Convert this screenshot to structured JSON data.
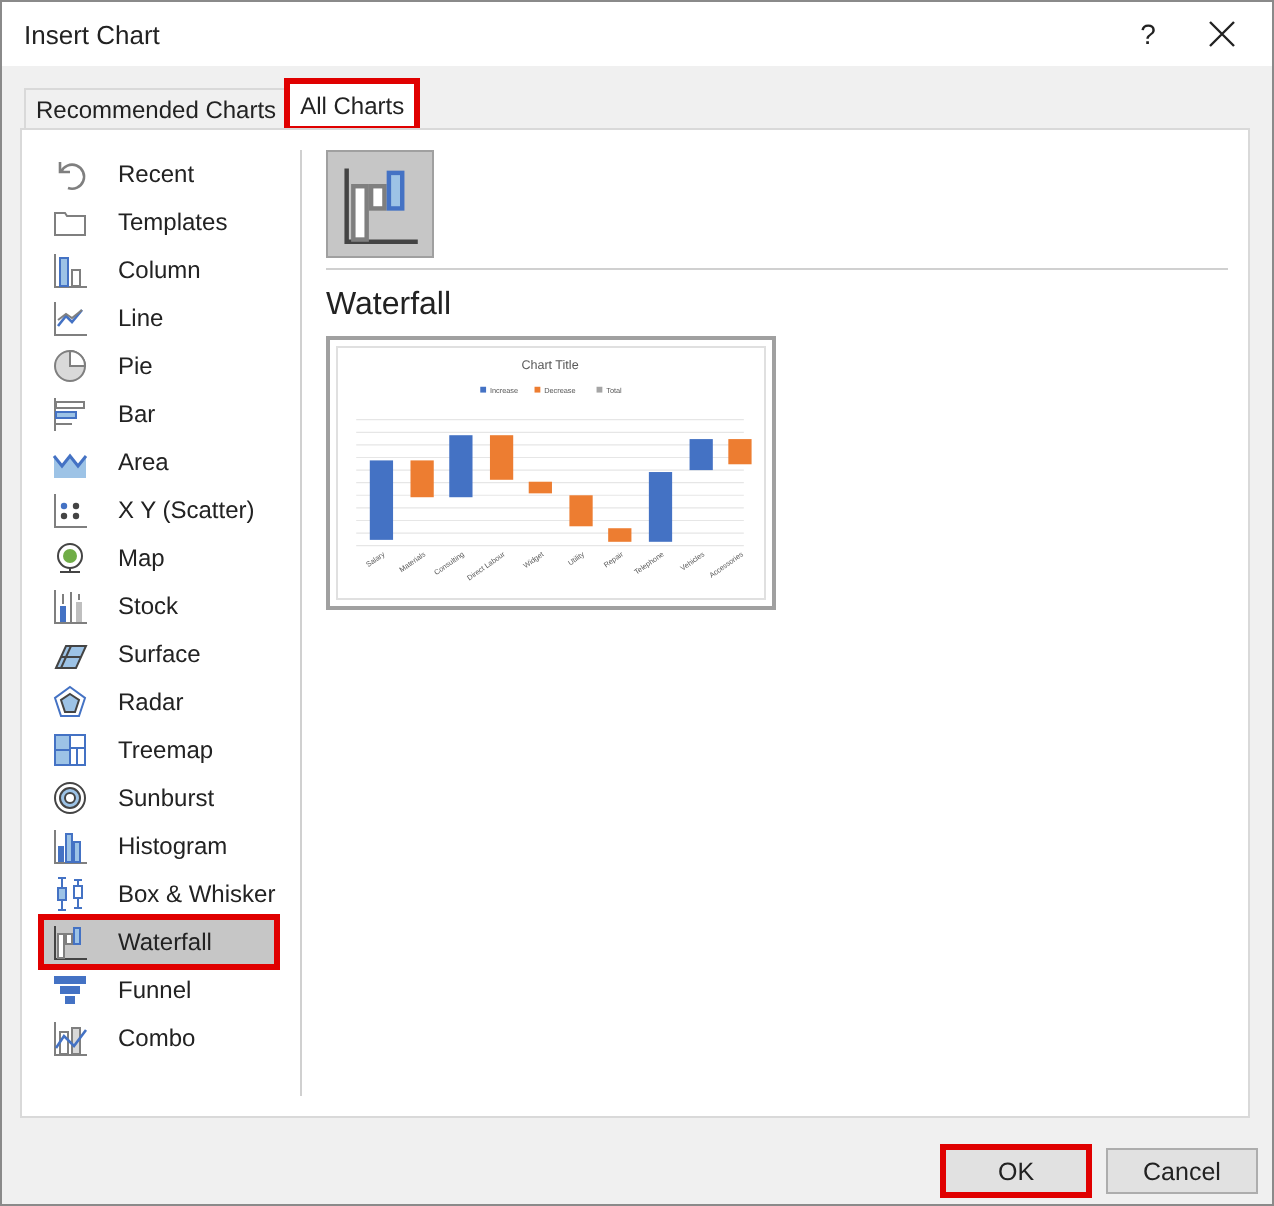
{
  "window": {
    "title": "Insert Chart",
    "help": "?"
  },
  "tabs": [
    {
      "label": "Recommended Charts",
      "selected": false,
      "highlighted": false
    },
    {
      "label": "All Charts",
      "selected": true,
      "highlighted": true
    }
  ],
  "sidebar": {
    "items": [
      {
        "label": "Recent",
        "kind": "recent",
        "selected": false,
        "highlighted": false
      },
      {
        "label": "Templates",
        "kind": "templates",
        "selected": false,
        "highlighted": false
      },
      {
        "label": "Column",
        "kind": "column",
        "selected": false,
        "highlighted": false
      },
      {
        "label": "Line",
        "kind": "line",
        "selected": false,
        "highlighted": false
      },
      {
        "label": "Pie",
        "kind": "pie",
        "selected": false,
        "highlighted": false
      },
      {
        "label": "Bar",
        "kind": "bar",
        "selected": false,
        "highlighted": false
      },
      {
        "label": "Area",
        "kind": "area",
        "selected": false,
        "highlighted": false
      },
      {
        "label": "X Y (Scatter)",
        "kind": "scatter",
        "selected": false,
        "highlighted": false
      },
      {
        "label": "Map",
        "kind": "map",
        "selected": false,
        "highlighted": false
      },
      {
        "label": "Stock",
        "kind": "stock",
        "selected": false,
        "highlighted": false
      },
      {
        "label": "Surface",
        "kind": "surface",
        "selected": false,
        "highlighted": false
      },
      {
        "label": "Radar",
        "kind": "radar",
        "selected": false,
        "highlighted": false
      },
      {
        "label": "Treemap",
        "kind": "treemap",
        "selected": false,
        "highlighted": false
      },
      {
        "label": "Sunburst",
        "kind": "sunburst",
        "selected": false,
        "highlighted": false
      },
      {
        "label": "Histogram",
        "kind": "histogram",
        "selected": false,
        "highlighted": false
      },
      {
        "label": "Box & Whisker",
        "kind": "box",
        "selected": false,
        "highlighted": false
      },
      {
        "label": "Waterfall",
        "kind": "waterfall",
        "selected": true,
        "highlighted": true
      },
      {
        "label": "Funnel",
        "kind": "funnel",
        "selected": false,
        "highlighted": false
      },
      {
        "label": "Combo",
        "kind": "combo",
        "selected": false,
        "highlighted": false
      }
    ]
  },
  "subtypes": [
    {
      "kind": "waterfall",
      "selected": true
    }
  ],
  "heading": "Waterfall",
  "preview": {
    "title": "Chart Title",
    "legend": [
      {
        "label": "Increase",
        "color": "#4472c4"
      },
      {
        "label": "Decrease",
        "color": "#ed7d31"
      },
      {
        "label": "Total",
        "color": "#a5a5a5"
      }
    ],
    "categories": [
      "Salary",
      "Materials",
      "Consulting",
      "Direct Labour",
      "Widget",
      "Utility",
      "Repair",
      "Telephone",
      "Vehicles",
      "Accessories"
    ]
  },
  "buttons": [
    {
      "label": "OK",
      "highlighted": true
    },
    {
      "label": "Cancel",
      "highlighted": false
    }
  ]
}
